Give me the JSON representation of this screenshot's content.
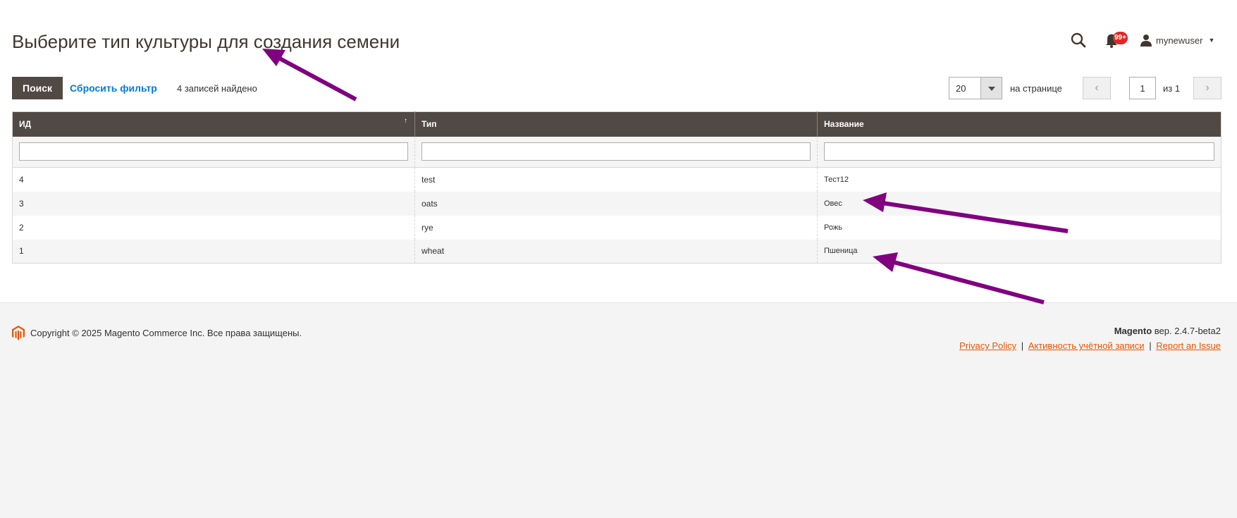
{
  "page": {
    "title": "Выберите тип культуры для создания семени"
  },
  "header": {
    "notifications_count": "99+",
    "username": "mynewuser"
  },
  "toolbar": {
    "search_label": "Поиск",
    "reset_label": "Сбросить фильтр",
    "records_found": "4 записей найдено",
    "per_page_value": "20",
    "per_page_label": "на странице",
    "current_page": "1",
    "total_pages_label": "из 1"
  },
  "grid": {
    "columns": [
      "ИД",
      "Тип",
      "Название"
    ],
    "sort_indicator": "↑",
    "rows": [
      {
        "id": "4",
        "type": "test",
        "name": "Тест12"
      },
      {
        "id": "3",
        "type": "oats",
        "name": "Овес"
      },
      {
        "id": "2",
        "type": "rye",
        "name": "Рожь"
      },
      {
        "id": "1",
        "type": "wheat",
        "name": "Пшеница"
      }
    ]
  },
  "footer": {
    "copyright": "Copyright © 2025 Magento Commerce Inc. Все права защищены.",
    "brand": "Magento",
    "version": " вер. 2.4.7-beta2",
    "links": [
      "Privacy Policy",
      "Активность учётной записи",
      "Report an Issue"
    ],
    "separator": "|"
  },
  "colors": {
    "header_bg": "#514943",
    "link": "#007bdb",
    "footer_link": "#eb5202",
    "badge": "#e22626",
    "annotation_arrow": "#800080"
  }
}
